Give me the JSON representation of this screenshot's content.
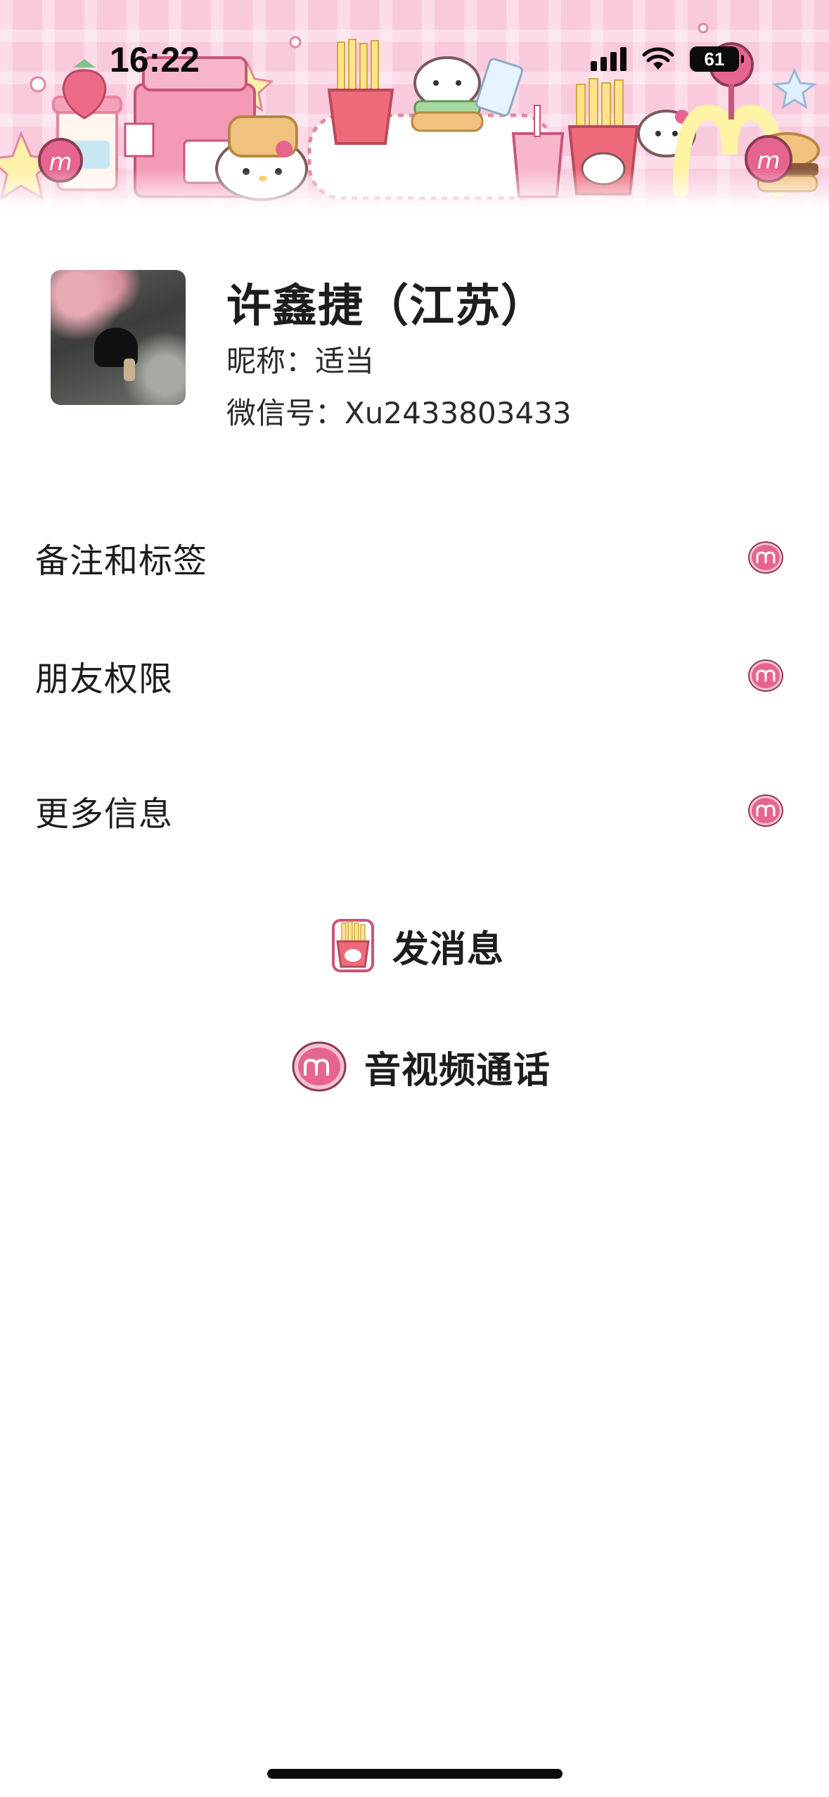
{
  "status_bar": {
    "time": "16:22",
    "battery": "61"
  },
  "profile": {
    "name": "许鑫捷（江苏）",
    "nickname": "昵称：适当",
    "wechat_id": "微信号：Xu2433803433"
  },
  "menu": {
    "items": [
      {
        "label": "备注和标签"
      },
      {
        "label": "朋友权限"
      },
      {
        "label": "更多信息"
      }
    ]
  },
  "actions": {
    "message": "发消息",
    "call": "音视频通话"
  },
  "colors": {
    "accent_pink": "#e6658f",
    "banner_pink": "#f9c9dc"
  },
  "icons": [
    "chevron-sticker-icon",
    "fries-sticker-icon",
    "m-badge-icon"
  ]
}
